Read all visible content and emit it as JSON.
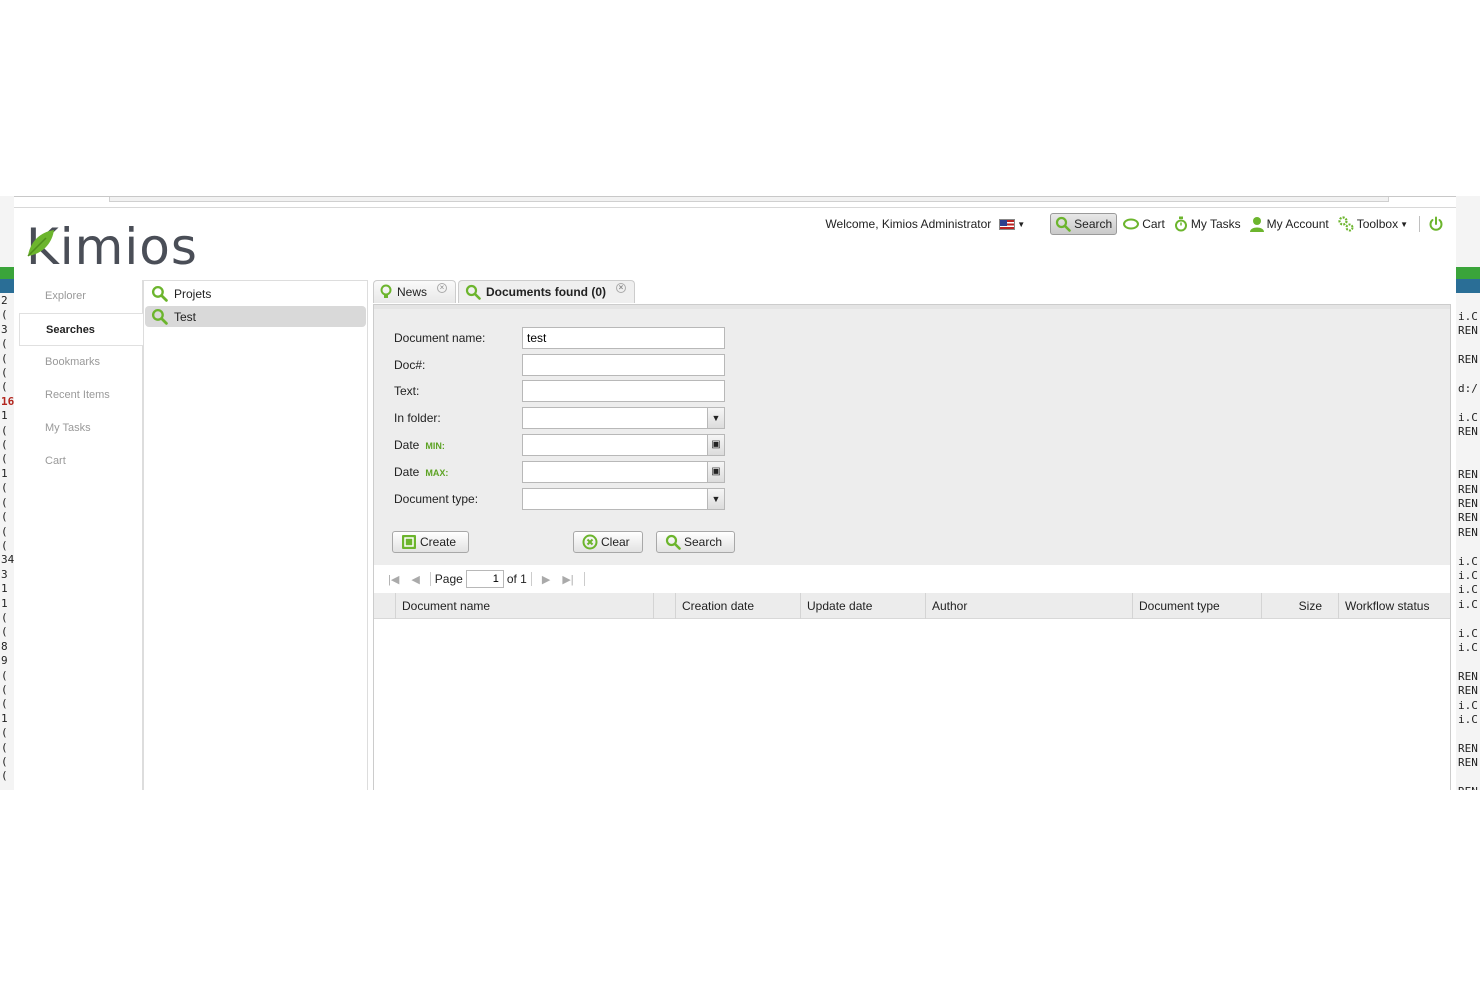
{
  "terminal": {
    "left_lines": [
      "2",
      "(",
      "3",
      "(",
      "(",
      "(",
      "(",
      "16",
      "1",
      "(",
      "(",
      "(",
      "1",
      "(",
      "(",
      "(",
      "(",
      "(",
      "34",
      "3",
      "1",
      "1",
      "(",
      "(",
      "8",
      "9",
      "(",
      "(",
      "(",
      "1",
      "(",
      "(",
      "(",
      "("
    ],
    "right_lines": [
      "i.C",
      "REN",
      "",
      "REN",
      "",
      "d:/",
      "",
      "i.C",
      "REN",
      "",
      "",
      "REN",
      "REN",
      "REN",
      "REN",
      "REN",
      "",
      "i.C",
      "i.C",
      "i.C",
      "i.C",
      "",
      "i.C",
      "i.C",
      "",
      "REN",
      "REN",
      "i.C",
      "i.C",
      "",
      "REN",
      "REN",
      "",
      "REN"
    ]
  },
  "app": {
    "logo": "Kimios",
    "welcome": "Welcome, Kimios Administrator",
    "topmenu": {
      "search": "Search",
      "cart": "Cart",
      "my_tasks": "My Tasks",
      "my_account": "My Account",
      "toolbox": "Toolbox"
    },
    "accent_color": "#6cb52d"
  },
  "leftnav": {
    "items": [
      "Explorer",
      "Searches",
      "Bookmarks",
      "Recent Items",
      "My Tasks",
      "Cart"
    ],
    "active": "Searches"
  },
  "searches": {
    "items": [
      "Projets",
      "Test"
    ],
    "selected": "Test"
  },
  "tabs": [
    {
      "label": "News"
    },
    {
      "label": "Documents found (0)"
    }
  ],
  "form": {
    "document_name": {
      "label": "Document name:",
      "value": "test"
    },
    "doc_number": {
      "label": "Doc#:",
      "value": ""
    },
    "text": {
      "label": "Text:",
      "value": ""
    },
    "in_folder": {
      "label": "In folder:",
      "value": ""
    },
    "date_min": {
      "label": "Date",
      "tag": "MIN:",
      "value": ""
    },
    "date_max": {
      "label": "Date",
      "tag": "MAX:",
      "value": ""
    },
    "document_type": {
      "label": "Document type:",
      "value": ""
    },
    "buttons": {
      "create": "Create",
      "clear": "Clear",
      "search": "Search"
    }
  },
  "pager": {
    "page_label": "Page",
    "page_value": "1",
    "of_label": "of 1"
  },
  "grid": {
    "columns": [
      "Document name",
      "Creation date",
      "Update date",
      "Author",
      "Document type",
      "Size",
      "Workflow status"
    ],
    "rows": []
  }
}
